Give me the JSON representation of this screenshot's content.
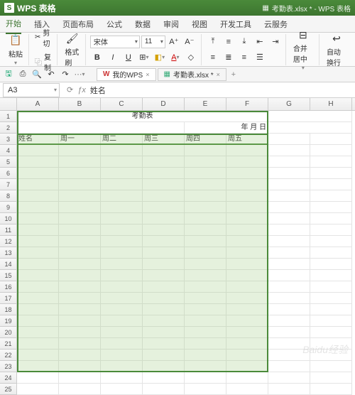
{
  "app": {
    "logo": "S",
    "name": "WPS 表格",
    "docIcon": "▦",
    "doc": "考勤表.xlsx * - WPS 表格"
  },
  "menu": {
    "items": [
      "开始",
      "插入",
      "页面布局",
      "公式",
      "数据",
      "审阅",
      "视图",
      "开发工具",
      "云服务"
    ],
    "active": 0
  },
  "ribbon": {
    "paste": "粘贴",
    "cut": "剪切",
    "copy": "复制",
    "format": "格式刷",
    "font": "宋体",
    "size": "11",
    "merge": "合并居中",
    "auto": "自动换行"
  },
  "qat": {
    "mywps": "我的WPS",
    "tab1": "考勤表.xlsx *"
  },
  "cellref": {
    "name": "A3",
    "fx": "ƒx",
    "value": "姓名"
  },
  "cols": [
    "A",
    "B",
    "C",
    "D",
    "E",
    "F",
    "G",
    "H"
  ],
  "sheet": {
    "r1": {
      "title": "考勤表"
    },
    "r2": {
      "date": "年    月    日"
    },
    "r3": [
      "姓名",
      "周一",
      "周二",
      "周三",
      "周四",
      "周五"
    ]
  },
  "watermark": "Baidu经验"
}
